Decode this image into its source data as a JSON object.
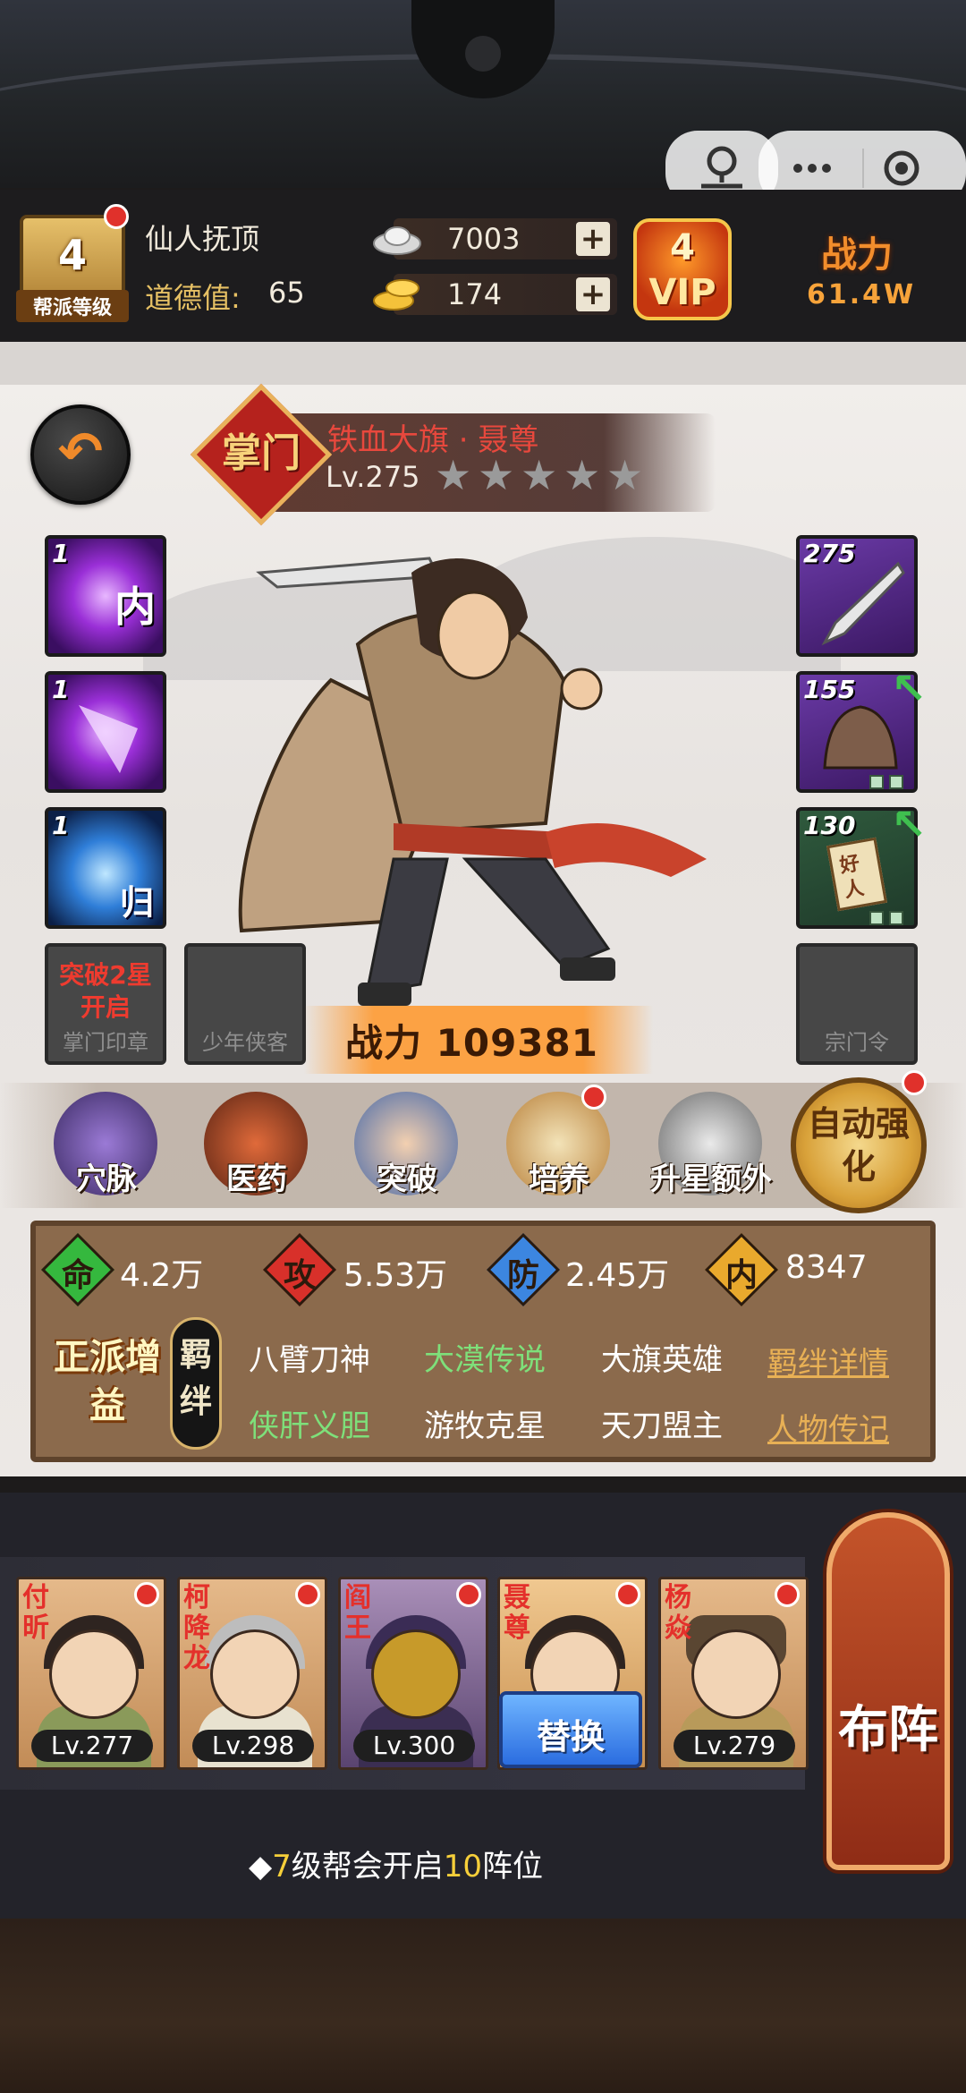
{
  "header": {
    "gang_level": "4",
    "gang_level_label": "帮派等级",
    "player_name": "仙人抚顶",
    "morality_label": "道德值:",
    "morality_value": "65",
    "silver": "7003",
    "gold": "174",
    "vip_level": "4",
    "vip_label": "VIP",
    "power_label": "战力",
    "power_value": "61.4W"
  },
  "hero": {
    "rank_char": "掌门",
    "name": "铁血大旗 · 聂尊",
    "level": "Lv.275",
    "stars": 5,
    "power_label": "战力",
    "power_value": "109381"
  },
  "skills": [
    {
      "level": "1",
      "char": "内"
    },
    {
      "level": "1",
      "char": ""
    },
    {
      "level": "1",
      "char": "归"
    }
  ],
  "equipment": [
    {
      "level": "275"
    },
    {
      "level": "155"
    },
    {
      "level": "130",
      "char": "好人"
    }
  ],
  "special_slots": {
    "seal_locked_text": "突破2星开启",
    "seal_label": "掌门印章",
    "youth_label": "少年侠客",
    "sect_label": "宗门令"
  },
  "actions": [
    {
      "label": "穴脉"
    },
    {
      "label": "医药"
    },
    {
      "label": "突破"
    },
    {
      "label": "培养"
    },
    {
      "label": "升星额外"
    }
  ],
  "auto_enhance": "自动强化",
  "stats": [
    {
      "char": "命",
      "value": "4.2万",
      "color": "#35b83e"
    },
    {
      "char": "攻",
      "value": "5.53万",
      "color": "#d8302a"
    },
    {
      "char": "防",
      "value": "2.45万",
      "color": "#3c86e0"
    },
    {
      "char": "内",
      "value": "8347",
      "color": "#e9a92d"
    }
  ],
  "righteous_bonus": "正派增益",
  "bond_tag": "羁绊",
  "bonds": [
    {
      "text": "八臂刀神",
      "active": false
    },
    {
      "text": "大漠传说",
      "active": true
    },
    {
      "text": "大旗英雄",
      "active": false
    },
    {
      "text": "侠肝义胆",
      "active": true
    },
    {
      "text": "游牧克星",
      "active": false
    },
    {
      "text": "天刀盟主",
      "active": false
    }
  ],
  "links": {
    "bond_details": "羁绊详情",
    "biography": "人物传记"
  },
  "lineup": [
    {
      "name": "付昕",
      "level": "Lv.277"
    },
    {
      "name": "柯降龙",
      "level": "Lv.298"
    },
    {
      "name": "阎王",
      "level": "Lv.300"
    },
    {
      "name": "聂尊",
      "level": ""
    },
    {
      "name": "杨焱",
      "level": "Lv.279"
    }
  ],
  "swap_button": "替换",
  "formation_button": "布阵",
  "hint": {
    "prefix": "◆",
    "n1": "7",
    "mid": "级帮会开启",
    "n2": "10",
    "suffix": "阵位"
  }
}
